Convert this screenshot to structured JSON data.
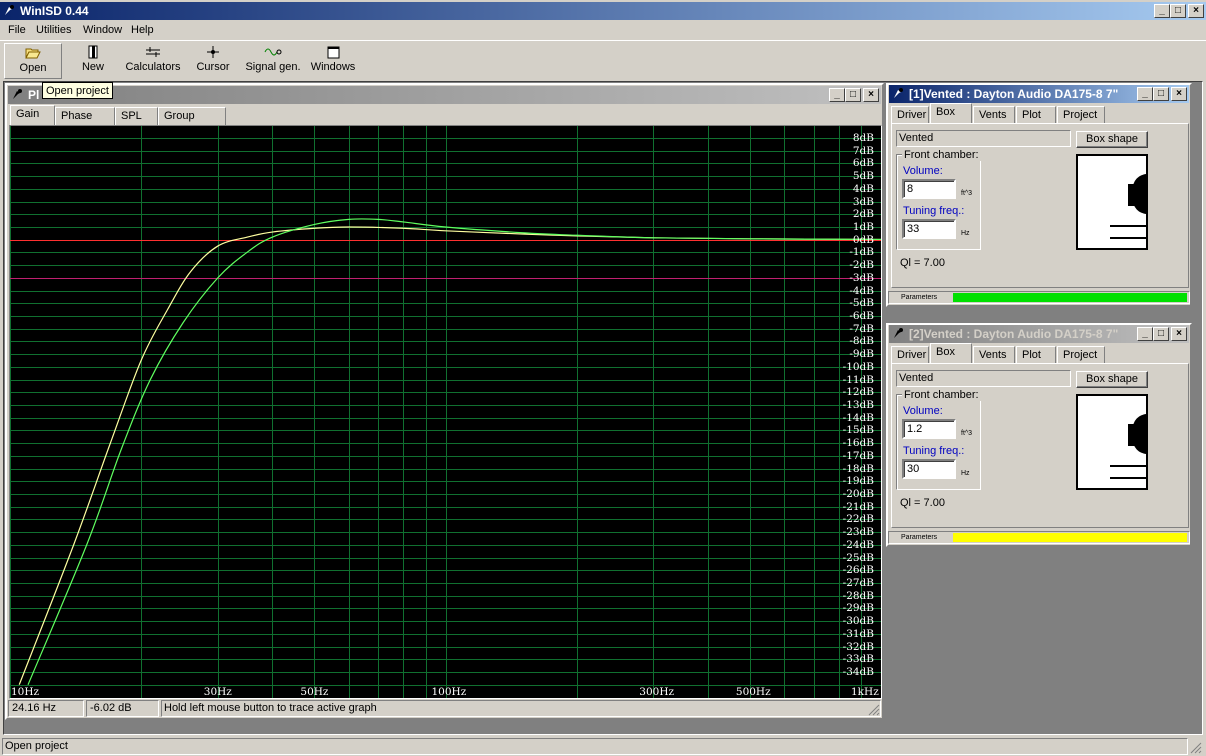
{
  "app": {
    "title": "WinISD 0.44",
    "menu": [
      "File",
      "Utilities",
      "Window",
      "Help"
    ],
    "toolbar": [
      {
        "label": "Open",
        "icon": "folder-open-icon"
      },
      {
        "label": "New",
        "icon": "new-document-icon"
      },
      {
        "label": "Calculators",
        "icon": "calculator-icon"
      },
      {
        "label": "Cursor",
        "icon": "cursor-icon"
      },
      {
        "label": "Signal gen.",
        "icon": "signal-generator-icon"
      },
      {
        "label": "Windows",
        "icon": "window-icon"
      }
    ],
    "tooltip": "Open project",
    "status_text": "Open project"
  },
  "plot_window": {
    "title_visible": "Pl",
    "tabs": [
      "Gain",
      "Phase plot",
      "SPL",
      "Group delay"
    ],
    "active_tab": "Gain",
    "status": {
      "freq": "24.16 Hz",
      "gain": "-6.02 dB",
      "hint": "Hold left mouse button to trace active graph"
    }
  },
  "chart_data": {
    "type": "line",
    "xscale": "log",
    "xlim": [
      10,
      1000
    ],
    "ylim": [
      -35,
      9
    ],
    "x_tick_labels": [
      "10Hz",
      "30Hz",
      "50Hz",
      "100Hz",
      "300Hz",
      "500Hz",
      "1kHz"
    ],
    "x_tick_values": [
      10,
      30,
      50,
      100,
      300,
      500,
      1000
    ],
    "y_tick_labels": [
      "8dB",
      "7dB",
      "6dB",
      "5dB",
      "4dB",
      "3dB",
      "2dB",
      "1dB",
      "0dB",
      "-1dB",
      "-2dB",
      "-3dB",
      "-4dB",
      "-5dB",
      "-6dB",
      "-7dB",
      "-8dB",
      "-9dB",
      "-10dB",
      "-11dB",
      "-12dB",
      "-13dB",
      "-14dB",
      "-15dB",
      "-16dB",
      "-17dB",
      "-18dB",
      "-19dB",
      "-20dB",
      "-21dB",
      "-22dB",
      "-23dB",
      "-24dB",
      "-25dB",
      "-26dB",
      "-27dB",
      "-28dB",
      "-29dB",
      "-30dB",
      "-31dB",
      "-32dB",
      "-33dB",
      "-34dB"
    ],
    "series": [
      {
        "color": "#ffffa0",
        "x": [
          10.5,
          14,
          17,
          20,
          23,
          26,
          30,
          35,
          40,
          50,
          60,
          80,
          100,
          150,
          200,
          300,
          500,
          1000
        ],
        "y": [
          -35,
          -24,
          -16,
          -9.5,
          -5.5,
          -2.5,
          -0.5,
          0.2,
          0.6,
          0.9,
          1.0,
          0.9,
          0.7,
          0.45,
          0.3,
          0.15,
          0.07,
          0.02
        ]
      },
      {
        "color": "#60ff60",
        "x": [
          11,
          15,
          18,
          21,
          25,
          30,
          35,
          40,
          50,
          60,
          70,
          80,
          100,
          150,
          200,
          300,
          500,
          1000
        ],
        "y": [
          -35,
          -24,
          -16.5,
          -11,
          -6.5,
          -3.0,
          -1.0,
          0.2,
          1.2,
          1.6,
          1.6,
          1.4,
          1.0,
          0.55,
          0.35,
          0.15,
          0.07,
          0.02
        ]
      }
    ],
    "reference_lines": [
      {
        "y": 0,
        "color": "#ff3030"
      },
      {
        "y": -3,
        "color": "#c02070"
      }
    ]
  },
  "project_windows": [
    {
      "title": "[1]Vented : Dayton Audio DA175-8 7\"",
      "active": true,
      "tabs": [
        "Driver",
        "Box",
        "Vents",
        "Plot",
        "Project"
      ],
      "active_tab": "Box",
      "box_type": "Vented",
      "box_shape_label": "Box shape",
      "front_chamber_label": "Front chamber:",
      "volume_label": "Volume:",
      "volume": "8",
      "volume_unit": "ft^3",
      "tuning_label": "Tuning freq.:",
      "tuning": "33",
      "tuning_unit": "Hz",
      "ql": "Ql = 7.00",
      "params_label": "Parameters",
      "params_color": "#00e000"
    },
    {
      "title": "[2]Vented : Dayton Audio DA175-8 7\"",
      "active": false,
      "tabs": [
        "Driver",
        "Box",
        "Vents",
        "Plot",
        "Project"
      ],
      "active_tab": "Box",
      "box_type": "Vented",
      "box_shape_label": "Box shape",
      "front_chamber_label": "Front chamber:",
      "volume_label": "Volume:",
      "volume": "1.2",
      "volume_unit": "ft^3",
      "tuning_label": "Tuning freq.:",
      "tuning": "30",
      "tuning_unit": "Hz",
      "ql": "Ql = 7.00",
      "params_label": "Parameters",
      "params_color": "#ffff00"
    }
  ]
}
